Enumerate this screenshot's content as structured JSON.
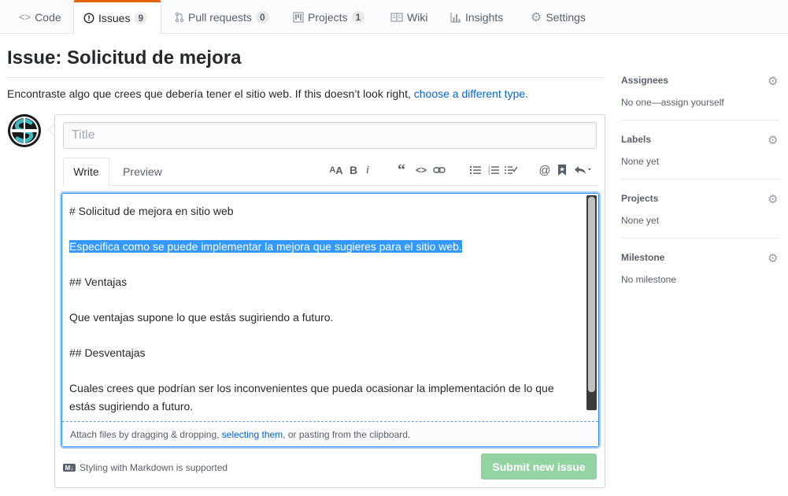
{
  "nav": {
    "tabs": [
      {
        "label": "Code",
        "icon": "code-icon"
      },
      {
        "label": "Issues",
        "icon": "issue-opened-icon",
        "count": "9"
      },
      {
        "label": "Pull requests",
        "icon": "pull-request-icon",
        "count": "0"
      },
      {
        "label": "Projects",
        "icon": "project-icon",
        "count": "1"
      },
      {
        "label": "Wiki",
        "icon": "book-icon"
      },
      {
        "label": "Insights",
        "icon": "graph-icon"
      },
      {
        "label": "Settings",
        "icon": "gear-icon"
      }
    ],
    "selected": "Issues",
    "accent": "#e36209"
  },
  "page": {
    "title": "Issue: Solicitud de mejora",
    "intro_text": "Encontraste algo que crees que debería tener el sitio web. If this doesn’t look right,",
    "intro_link": "choose a different type."
  },
  "composer": {
    "title_placeholder": "Title",
    "tabs": {
      "write": "Write",
      "preview": "Preview"
    },
    "editor_lines": [
      "# Solicitud de mejora en sitio web",
      "",
      "Especifica como se puede implementar la mejora que sugieres para el sitio web.",
      "",
      "## Ventajas",
      "",
      "Que ventajas supone lo que estás sugiriendo a futuro.",
      "",
      "## Desventajas",
      "",
      "Cuales crees que podrían ser los inconvenientes que pueda ocasionar la implementación de lo que estás sugiriendo a futuro."
    ],
    "selected_line_index": 2,
    "attach_prefix": "Attach files by dragging & dropping,",
    "attach_link": "selecting them",
    "attach_suffix": ", or pasting from the clipboard.",
    "markdown_note": "Styling with Markdown is supported",
    "markdown_badge": "M↓",
    "submit_label": "Submit new issue",
    "submit_color": "#94d3a2"
  },
  "sidebar": {
    "sections": [
      {
        "heading": "Assignees",
        "value": "No one—assign yourself"
      },
      {
        "heading": "Labels",
        "value": "None yet"
      },
      {
        "heading": "Projects",
        "value": "None yet"
      },
      {
        "heading": "Milestone",
        "value": "No milestone"
      }
    ]
  }
}
